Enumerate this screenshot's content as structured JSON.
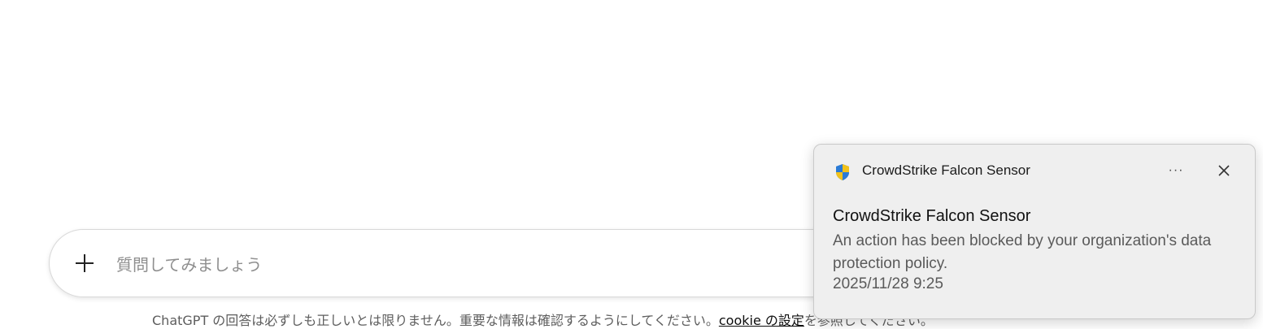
{
  "composer": {
    "placeholder": "質問してみましょう",
    "add_icon": "plus-icon"
  },
  "footer": {
    "disclaimer_prefix": "ChatGPT の回答は必ずしも正しいとは限りません。重要な情報は確認するようにしてください。",
    "cookie_link": "cookie の設定",
    "disclaimer_suffix": "を参照してください。"
  },
  "notification": {
    "app_name": "CrowdStrike Falcon Sensor",
    "app_icon": "shield-icon",
    "more_label": "···",
    "close_icon": "close-icon",
    "title": "CrowdStrike Falcon Sensor",
    "message": "An action has been blocked by your organization's data protection policy.",
    "timestamp": "2025/11/28 9:25"
  }
}
